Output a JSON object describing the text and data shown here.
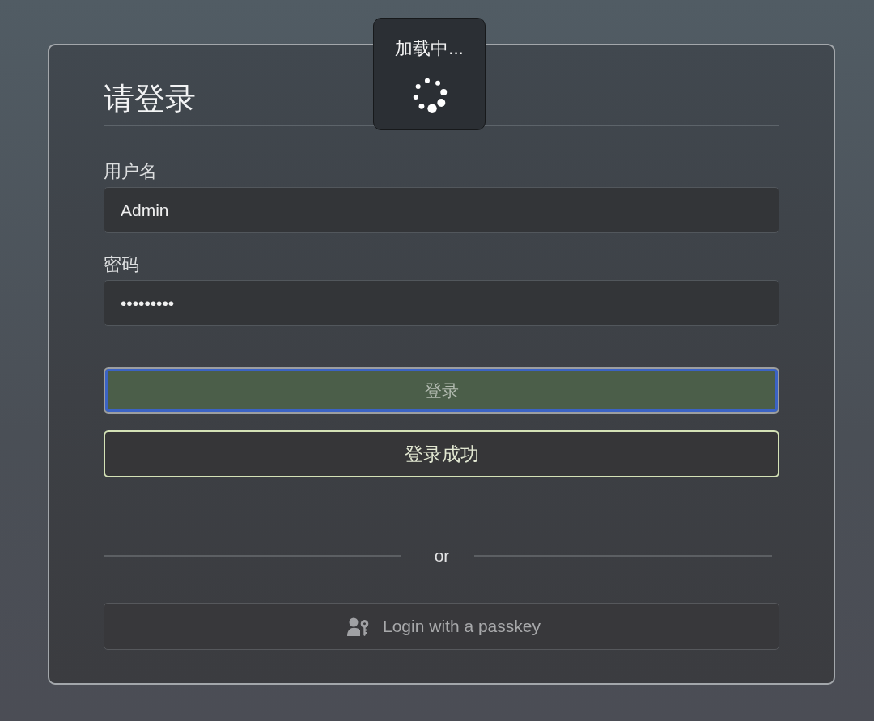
{
  "loading_overlay": {
    "text": "加载中..."
  },
  "login_form": {
    "title": "请登录",
    "fields": [
      {
        "label": "用户名",
        "value": "Admin"
      },
      {
        "label": "密码",
        "value": "•••••••••"
      }
    ],
    "submit_button": {
      "label": "登录",
      "focused": true
    },
    "status_message": {
      "text": "登录成功",
      "kind": "success"
    },
    "divider_text": "or",
    "passkey_button": {
      "label": "Login with a passkey"
    }
  }
}
